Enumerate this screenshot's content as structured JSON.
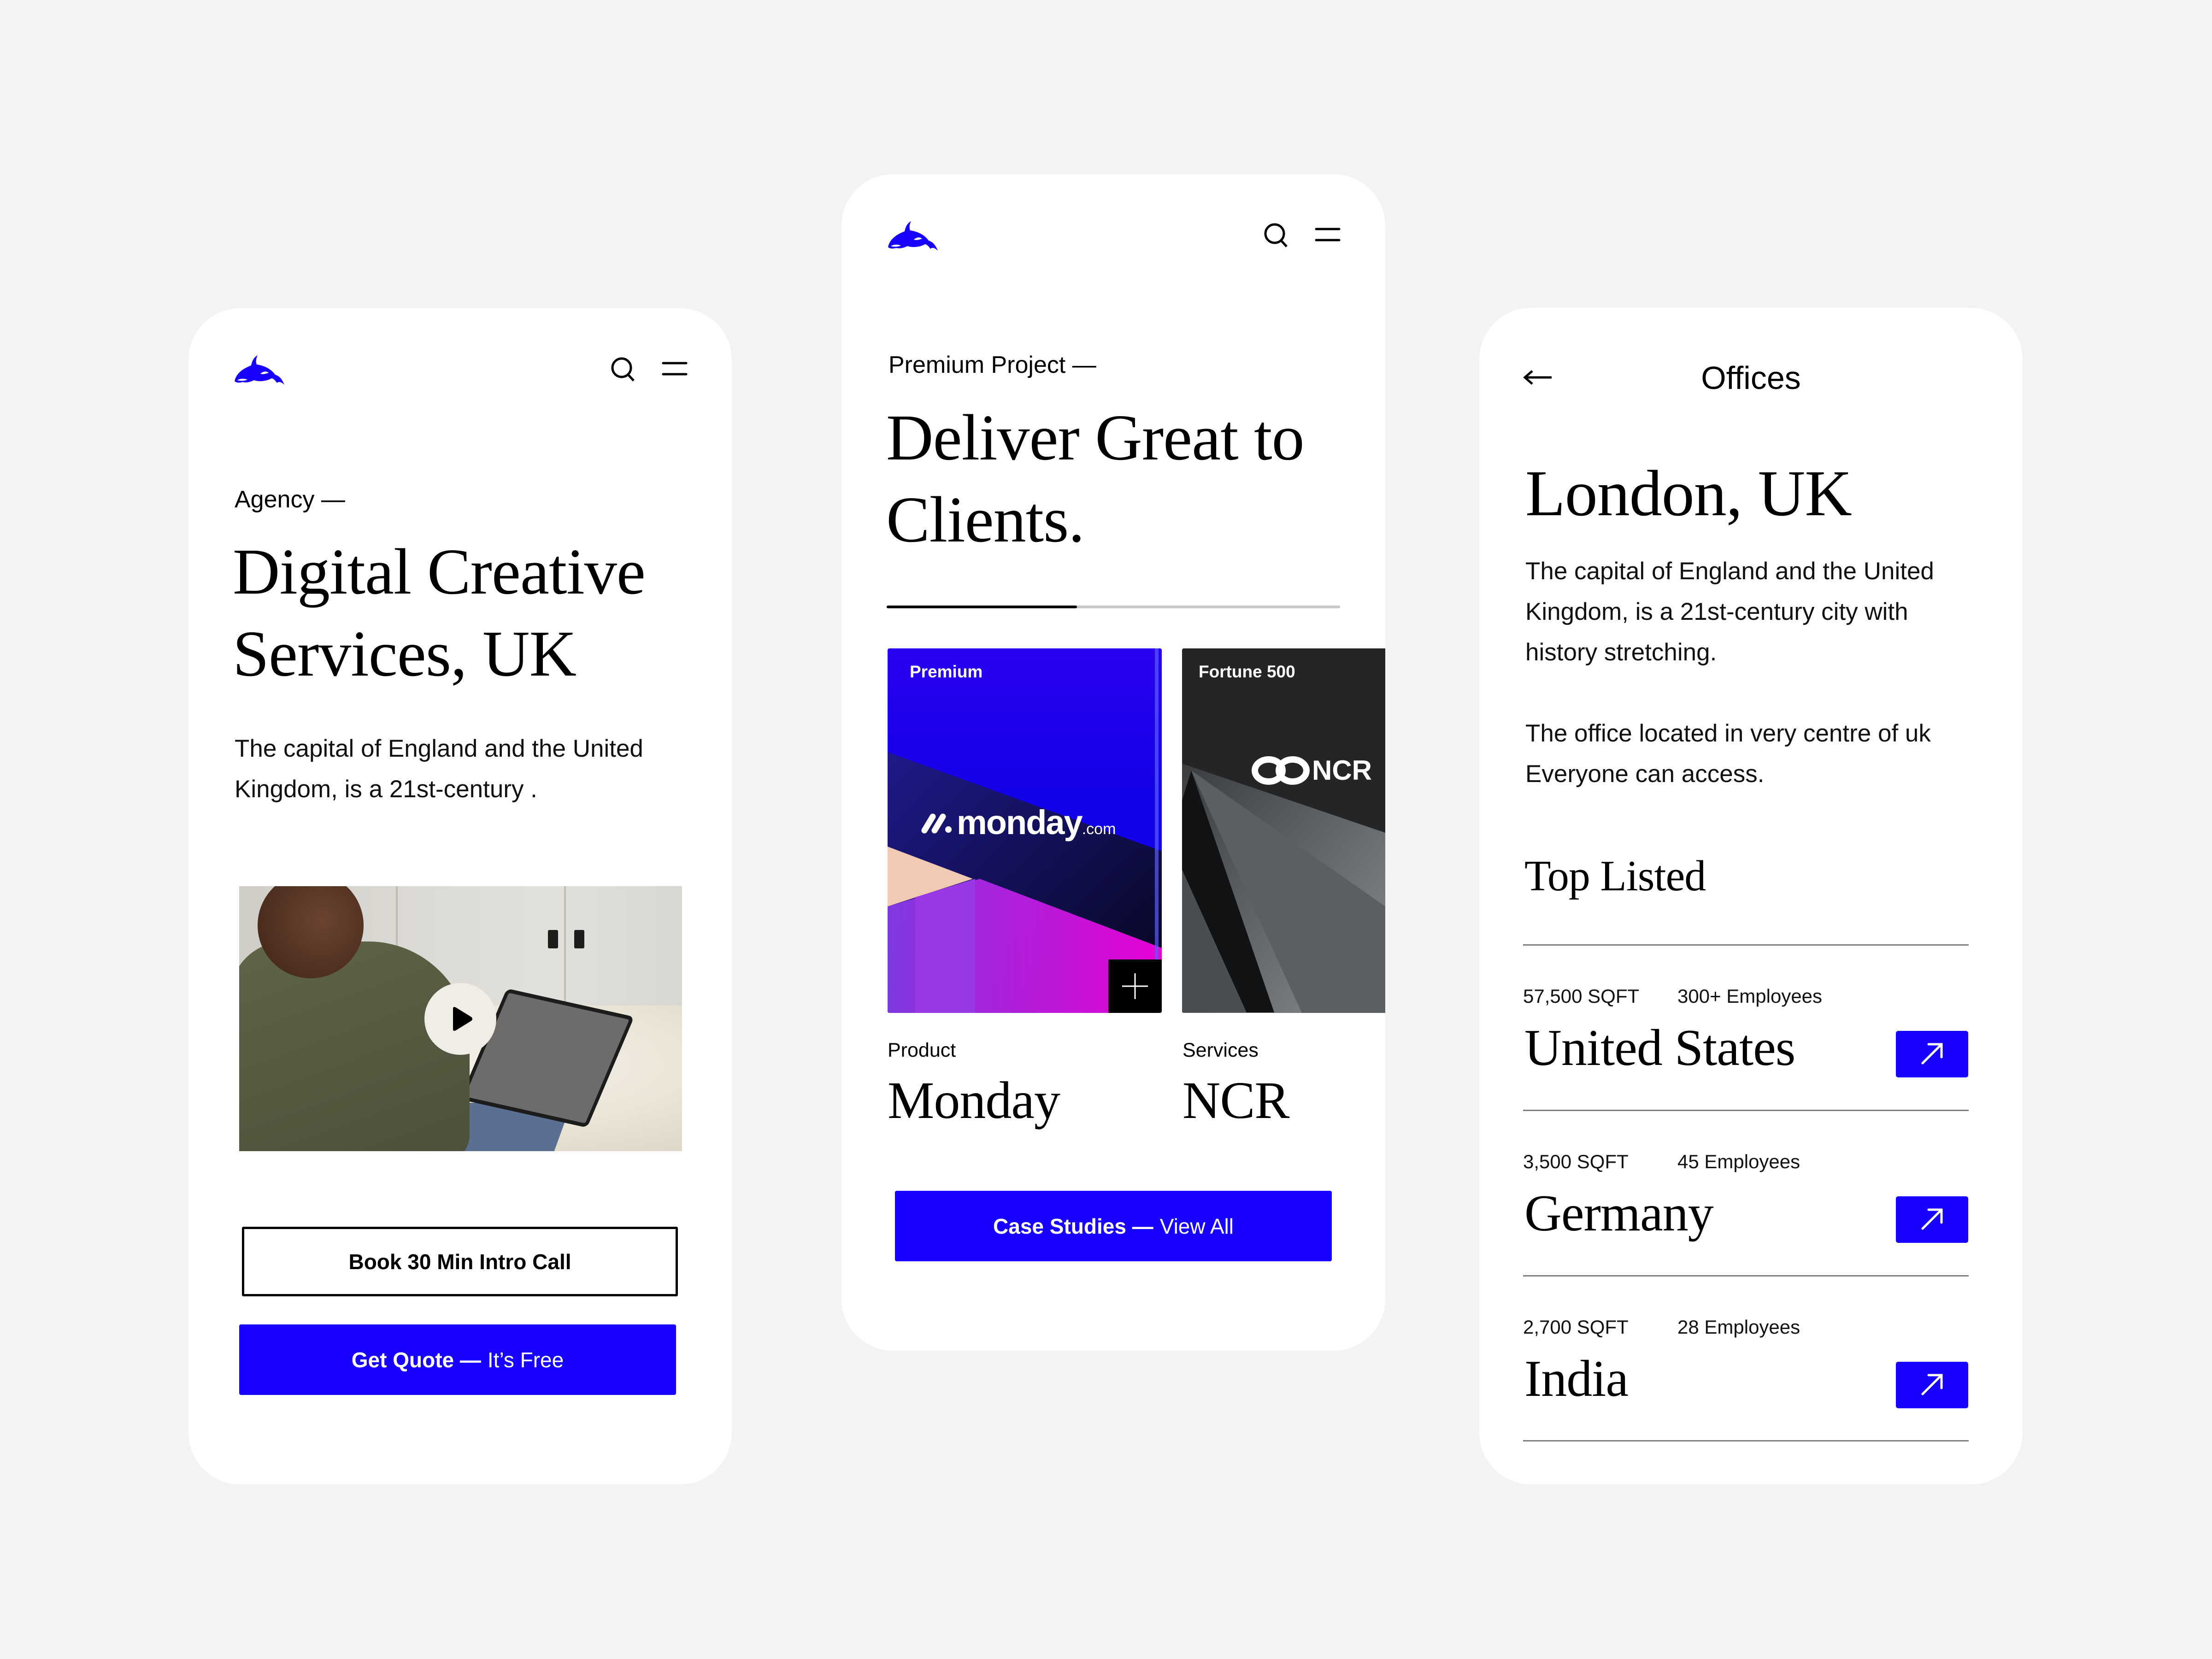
{
  "brand": {
    "accent_color": "#1800ff",
    "background_color": "#f3f3f3",
    "logo_icon": "orca-icon"
  },
  "screens": [
    {
      "id": "agency",
      "header": {
        "search_icon": "search-icon",
        "menu_icon": "menu-icon"
      },
      "eyebrow": "Agency —",
      "headline_lines": [
        "Digital Creative",
        "Services, UK"
      ],
      "body_lines": [
        "The capital of England and the United",
        "Kingdom, is a 21st-century ."
      ],
      "video": {
        "thumbnail": "woman-using-tablet-on-bed",
        "play_icon": "play-icon"
      },
      "buttons": {
        "secondary": "Book 30 Min Intro Call",
        "primary_strong": "Get Quote —",
        "primary_light": "It’s Free"
      }
    },
    {
      "id": "projects",
      "header": {
        "search_icon": "search-icon",
        "menu_icon": "menu-icon"
      },
      "eyebrow": "Premium Project —",
      "headline_lines": [
        "Deliver Great to",
        "Clients."
      ],
      "carousel_progress": 0.42,
      "projects": [
        {
          "tag": "Premium",
          "logo_text": "monday",
          "logo_suffix": ".com",
          "category": "Product",
          "name": "Monday"
        },
        {
          "tag": "Fortune 500",
          "logo_text": "NCR",
          "category": "Services",
          "name": "NCR"
        }
      ],
      "cta": {
        "strong": "Case Studies —",
        "light": "View All"
      }
    },
    {
      "id": "offices",
      "header": {
        "back_icon": "arrow-left-icon",
        "title": "Offices"
      },
      "city": "London, UK",
      "paragraph1_lines": [
        "The capital of England and the United",
        "Kingdom, is a 21st-century city with",
        "history stretching."
      ],
      "paragraph2_lines": [
        "The office located in very centre of uk",
        "Everyone can access."
      ],
      "list_title": "Top Listed",
      "offices": [
        {
          "sqft": "57,500 SQFT",
          "employees": "300+ Employees",
          "country": "United States"
        },
        {
          "sqft": "3,500 SQFT",
          "employees": "45 Employees",
          "country": "Germany"
        },
        {
          "sqft": "2,700 SQFT",
          "employees": "28 Employees",
          "country": "India"
        }
      ]
    }
  ]
}
